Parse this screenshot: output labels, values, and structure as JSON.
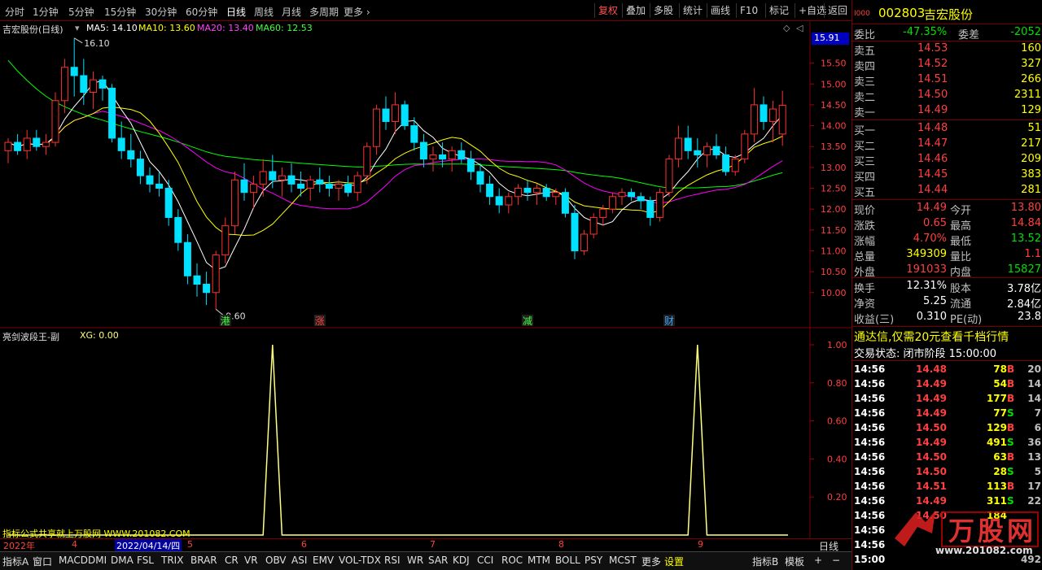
{
  "toolbar": {
    "periods": [
      "分时",
      "1分钟",
      "5分钟",
      "15分钟",
      "30分钟",
      "60分钟",
      "日线",
      "周线",
      "月线",
      "多周期",
      "更多"
    ],
    "active_period": "日线",
    "tools": [
      "复权",
      "叠加",
      "多股",
      "统计",
      "画线",
      "F10",
      "标记",
      "+自选",
      "返回"
    ]
  },
  "main": {
    "title": "吉宏股份(日线)",
    "ma5": "MA5: 14.10",
    "ma10": "MA10: 13.60",
    "ma20": "MA20: 13.40",
    "ma60": "MA60: 12.53",
    "high_label": "16.10",
    "low_label": "9.60",
    "current_price_tag": "15.91",
    "markers": [
      "港",
      "涨",
      "减",
      "财"
    ],
    "colors": {
      "ma5": "#ffffff",
      "ma10": "#ffff00",
      "ma20": "#ff00ff",
      "ma60": "#00ff00",
      "up": "#ff3030",
      "down": "#00e0ff"
    }
  },
  "indicator": {
    "title": "亮剑波段王-副",
    "xg": "XG: 0.00",
    "watermark": "指标公式共享就上万股网 WWW.201082.COM",
    "color": "#ffff80"
  },
  "date_axis": {
    "start": "2022年",
    "selected": "2022/04/14/四",
    "months": [
      "4",
      "5",
      "6",
      "7",
      "8",
      "9"
    ],
    "period_button": "日线"
  },
  "bottom_tabs": [
    "指标A",
    "窗口",
    "MACD",
    "DMI",
    "DMA",
    "FSL",
    "TRIX",
    "BRAR",
    "CR",
    "VR",
    "OBV",
    "ASI",
    "EMV",
    "VOL-TDX",
    "RSI",
    "WR",
    "SAR",
    "KDJ",
    "CCI",
    "ROC",
    "MTM",
    "BOLL",
    "PSY",
    "MCST",
    "更多",
    "设置"
  ],
  "bottom_right": [
    "指标B",
    "模板",
    "+",
    "−"
  ],
  "quote": {
    "code": "002803",
    "name": "吉宏股份",
    "weibi_label": "委比",
    "weibi": "-47.35%",
    "weicha_label": "委差",
    "weicha": "-2052",
    "asks": [
      {
        "label": "卖五",
        "price": "14.53",
        "vol": "160"
      },
      {
        "label": "卖四",
        "price": "14.52",
        "vol": "327"
      },
      {
        "label": "卖三",
        "price": "14.51",
        "vol": "266"
      },
      {
        "label": "卖二",
        "price": "14.50",
        "vol": "2311"
      },
      {
        "label": "卖一",
        "price": "14.49",
        "vol": "129"
      }
    ],
    "bids": [
      {
        "label": "买一",
        "price": "14.48",
        "vol": "51"
      },
      {
        "label": "买二",
        "price": "14.47",
        "vol": "217"
      },
      {
        "label": "买三",
        "price": "14.46",
        "vol": "209"
      },
      {
        "label": "买四",
        "price": "14.45",
        "vol": "383"
      },
      {
        "label": "买五",
        "price": "14.44",
        "vol": "281"
      }
    ],
    "stats": [
      {
        "l1": "现价",
        "v1": "14.49",
        "c1": "red",
        "l2": "今开",
        "v2": "13.80",
        "c2": "red"
      },
      {
        "l1": "涨跌",
        "v1": "0.65",
        "c1": "red",
        "l2": "最高",
        "v2": "14.84",
        "c2": "red"
      },
      {
        "l1": "涨幅",
        "v1": "4.70%",
        "c1": "red",
        "l2": "最低",
        "v2": "13.52",
        "c2": "green"
      },
      {
        "l1": "总量",
        "v1": "349309",
        "c1": "yellow",
        "l2": "量比",
        "v2": "1.1",
        "c2": "red"
      },
      {
        "l1": "外盘",
        "v1": "191033",
        "c1": "red",
        "l2": "内盘",
        "v2": "15827",
        "c2": "green"
      }
    ],
    "stats2": [
      {
        "l1": "换手",
        "v1": "12.31%",
        "l2": "股本",
        "v2": "3.78亿"
      },
      {
        "l1": "净资",
        "v1": "5.25",
        "l2": "流通",
        "v2": "2.84亿"
      },
      {
        "l1": "收益(三)",
        "v1": "0.310",
        "l2": "PE(动)",
        "v2": "23.8"
      }
    ],
    "promo": "通达信,仅需20元查看千档行情",
    "trade_status": "交易状态: 闭市阶段 15:00:00"
  },
  "ticks": [
    {
      "time": "14:56",
      "price": "14.48",
      "vol": "78",
      "side": "B",
      "n": "20"
    },
    {
      "time": "14:56",
      "price": "14.49",
      "vol": "54",
      "side": "B",
      "n": "14"
    },
    {
      "time": "14:56",
      "price": "14.49",
      "vol": "177",
      "side": "B",
      "n": "14"
    },
    {
      "time": "14:56",
      "price": "14.49",
      "vol": "77",
      "side": "S",
      "n": "7"
    },
    {
      "time": "14:56",
      "price": "14.50",
      "vol": "129",
      "side": "B",
      "n": "6"
    },
    {
      "time": "14:56",
      "price": "14.49",
      "vol": "491",
      "side": "S",
      "n": "36"
    },
    {
      "time": "14:56",
      "price": "14.50",
      "vol": "63",
      "side": "B",
      "n": "13"
    },
    {
      "time": "14:56",
      "price": "14.50",
      "vol": "28",
      "side": "S",
      "n": "5"
    },
    {
      "time": "14:56",
      "price": "14.51",
      "vol": "113",
      "side": "B",
      "n": "17"
    },
    {
      "time": "14:56",
      "price": "14.49",
      "vol": "311",
      "side": "S",
      "n": "22"
    },
    {
      "time": "14:56",
      "price": "14.50",
      "vol": "184",
      "side": "",
      "n": ""
    },
    {
      "time": "14:56",
      "price": "",
      "vol": "",
      "side": "",
      "n": ""
    },
    {
      "time": "14:56",
      "price": "",
      "vol": "",
      "side": "",
      "n": ""
    },
    {
      "time": "15:00",
      "price": "",
      "vol": "",
      "side": "",
      "n": "492"
    }
  ],
  "watermark": {
    "brand": "万股网",
    "url": "www.201082.com"
  },
  "chart_data": [
    {
      "type": "candlestick",
      "title": "吉宏股份(日线)",
      "y_ticks": [
        "15.50",
        "15.00",
        "14.50",
        "14.00",
        "13.50",
        "13.00",
        "12.50",
        "12.00",
        "11.50",
        "11.00",
        "10.50",
        "10.00"
      ],
      "ylim": [
        9.45,
        16.35
      ],
      "ohlc": [
        [
          13.4,
          13.7,
          13.1,
          13.6
        ],
        [
          13.6,
          13.8,
          13.3,
          13.4
        ],
        [
          13.4,
          13.9,
          13.2,
          13.7
        ],
        [
          13.7,
          13.9,
          13.4,
          13.5
        ],
        [
          13.5,
          13.8,
          13.3,
          13.6
        ],
        [
          13.6,
          14.8,
          13.5,
          14.6
        ],
        [
          14.6,
          15.6,
          14.3,
          15.4
        ],
        [
          15.4,
          16.1,
          14.7,
          15.2
        ],
        [
          15.2,
          15.6,
          14.5,
          14.8
        ],
        [
          14.8,
          15.3,
          14.4,
          15.1
        ],
        [
          15.1,
          15.2,
          14.6,
          14.9
        ],
        [
          14.9,
          15.0,
          13.6,
          13.7
        ],
        [
          13.7,
          14.1,
          13.2,
          13.4
        ],
        [
          13.4,
          13.8,
          13.0,
          13.2
        ],
        [
          13.2,
          13.4,
          12.6,
          12.8
        ],
        [
          12.8,
          13.0,
          12.4,
          12.6
        ],
        [
          12.6,
          12.9,
          12.3,
          12.5
        ],
        [
          12.5,
          12.7,
          11.6,
          11.8
        ],
        [
          11.8,
          12.0,
          11.0,
          11.2
        ],
        [
          11.2,
          11.4,
          10.2,
          10.4
        ],
        [
          10.4,
          10.7,
          9.9,
          10.2
        ],
        [
          10.2,
          10.5,
          9.7,
          10.0
        ],
        [
          10.0,
          11.0,
          9.6,
          10.9
        ],
        [
          10.9,
          11.8,
          10.7,
          11.6
        ],
        [
          11.6,
          12.9,
          11.4,
          12.7
        ],
        [
          12.7,
          13.1,
          12.2,
          12.4
        ],
        [
          12.4,
          12.8,
          12.0,
          12.6
        ],
        [
          12.6,
          13.2,
          12.3,
          12.9
        ],
        [
          12.9,
          13.3,
          12.5,
          12.7
        ],
        [
          12.7,
          13.0,
          12.3,
          12.8
        ],
        [
          12.8,
          13.1,
          12.4,
          12.6
        ],
        [
          12.6,
          12.9,
          12.3,
          12.5
        ],
        [
          12.5,
          12.8,
          12.2,
          12.7
        ],
        [
          12.7,
          13.0,
          12.4,
          12.6
        ],
        [
          12.6,
          12.8,
          12.3,
          12.5
        ],
        [
          12.5,
          12.7,
          12.2,
          12.6
        ],
        [
          12.6,
          12.8,
          12.3,
          12.4
        ],
        [
          12.4,
          12.9,
          12.2,
          12.8
        ],
        [
          12.8,
          13.6,
          12.6,
          13.5
        ],
        [
          13.5,
          14.5,
          13.3,
          14.4
        ],
        [
          14.4,
          14.7,
          13.9,
          14.1
        ],
        [
          14.1,
          14.8,
          13.8,
          14.5
        ],
        [
          14.5,
          14.6,
          13.9,
          14.0
        ],
        [
          14.0,
          14.2,
          13.4,
          13.6
        ],
        [
          13.6,
          13.8,
          13.0,
          13.2
        ],
        [
          13.2,
          13.5,
          12.9,
          13.3
        ],
        [
          13.3,
          13.6,
          13.0,
          13.2
        ],
        [
          13.2,
          13.5,
          12.9,
          13.4
        ],
        [
          13.4,
          13.6,
          13.1,
          13.2
        ],
        [
          13.2,
          13.4,
          12.7,
          12.9
        ],
        [
          12.9,
          13.1,
          12.4,
          12.6
        ],
        [
          12.6,
          12.8,
          12.1,
          12.3
        ],
        [
          12.3,
          12.5,
          11.9,
          12.1
        ],
        [
          12.1,
          12.4,
          11.9,
          12.3
        ],
        [
          12.3,
          12.6,
          12.1,
          12.5
        ],
        [
          12.5,
          12.7,
          12.2,
          12.4
        ],
        [
          12.4,
          12.6,
          12.1,
          12.5
        ],
        [
          12.5,
          12.6,
          12.2,
          12.3
        ],
        [
          12.3,
          12.5,
          12.1,
          12.4
        ],
        [
          12.4,
          12.5,
          11.8,
          11.9
        ],
        [
          11.9,
          12.1,
          10.8,
          11.0
        ],
        [
          11.0,
          11.5,
          10.9,
          11.4
        ],
        [
          11.4,
          11.9,
          11.3,
          11.8
        ],
        [
          11.8,
          12.1,
          11.6,
          12.0
        ],
        [
          12.0,
          12.4,
          11.9,
          12.3
        ],
        [
          12.3,
          12.5,
          12.1,
          12.4
        ],
        [
          12.4,
          12.5,
          12.2,
          12.3
        ],
        [
          12.3,
          12.4,
          12.0,
          12.2
        ],
        [
          12.2,
          12.3,
          11.6,
          11.8
        ],
        [
          11.8,
          12.5,
          11.7,
          12.4
        ],
        [
          12.4,
          13.3,
          12.3,
          13.2
        ],
        [
          13.2,
          14.0,
          13.0,
          13.7
        ],
        [
          13.7,
          14.0,
          13.2,
          13.4
        ],
        [
          13.4,
          13.7,
          13.0,
          13.3
        ],
        [
          13.3,
          13.6,
          13.0,
          13.5
        ],
        [
          13.5,
          13.8,
          13.2,
          13.3
        ],
        [
          13.3,
          13.5,
          12.8,
          12.9
        ],
        [
          12.9,
          13.3,
          12.8,
          13.2
        ],
        [
          13.2,
          13.9,
          13.1,
          13.8
        ],
        [
          13.8,
          14.9,
          13.6,
          14.5
        ],
        [
          14.5,
          14.7,
          13.9,
          14.1
        ],
        [
          14.1,
          14.6,
          13.6,
          14.4
        ],
        [
          13.8,
          14.84,
          13.52,
          14.49
        ]
      ]
    },
    {
      "type": "line",
      "title": "亮剑波段王-副",
      "y_ticks": [
        "1.00",
        "0.80",
        "0.60",
        "0.40",
        "0.20"
      ],
      "ylim": [
        0,
        1
      ],
      "series": [
        {
          "name": "XG",
          "spikes_at_index": [
            28,
            73
          ],
          "values_elsewhere": 0
        }
      ]
    }
  ]
}
